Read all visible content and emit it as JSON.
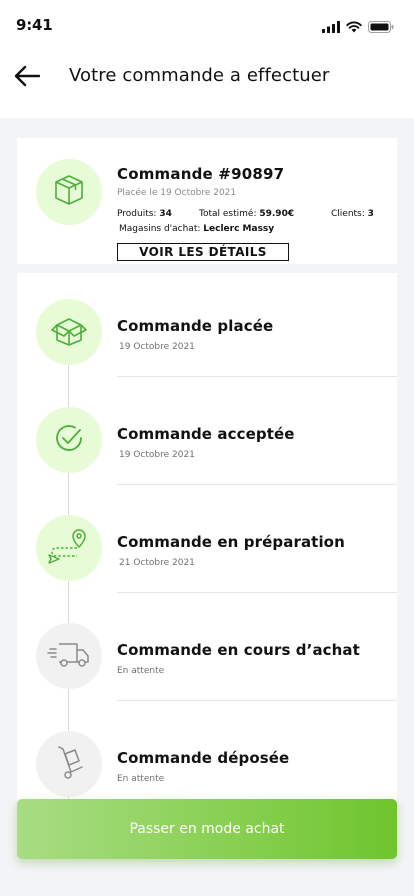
{
  "status_bar": {
    "time": "9:41"
  },
  "header": {
    "title": "Votre commande a effectuer"
  },
  "order": {
    "title": "Commande #90897",
    "placed": "Placée le 19 Octobre 2021",
    "products_label": "Produits:",
    "products_value": "34",
    "total_label": "Total estimé:",
    "total_value": "59.90€",
    "clients_label": "Clients:",
    "clients_value": "3",
    "store_label": "Magasins d'achat:",
    "store_value": "Leclerc Massy",
    "details_button": "VOIR LES DÉTAILS"
  },
  "steps": [
    {
      "title": "Commande placée",
      "date": "19 Octobre 2021",
      "icon": "box-open-icon",
      "state": "done"
    },
    {
      "title": "Commande acceptée",
      "date": "19 Octobre 2021",
      "icon": "check-circle-icon",
      "state": "done"
    },
    {
      "title": "Commande en préparation",
      "date": "21 Octobre 2021",
      "icon": "route-pin-icon",
      "state": "done"
    },
    {
      "title": "Commande en cours d’achat",
      "date": "En attente",
      "icon": "delivery-truck-icon",
      "state": "pending"
    },
    {
      "title": "Commande déposée",
      "date": "En attente",
      "icon": "hand-truck-icon",
      "state": "pending"
    }
  ],
  "cta": {
    "label": "Passer en mode achat"
  },
  "colors": {
    "accent": "#6fc52c",
    "accent_light": "#e7fbd6",
    "icon_green": "#4caf3a",
    "pending_gray": "#8a8a8a"
  }
}
